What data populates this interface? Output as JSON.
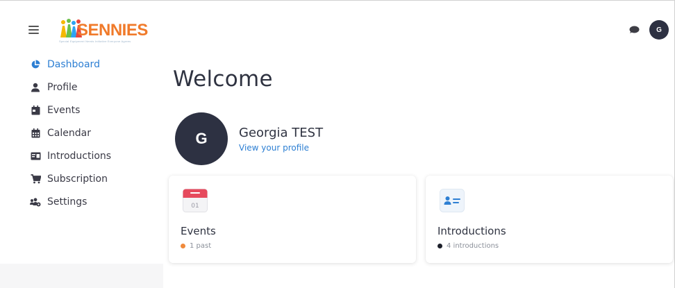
{
  "app": {
    "logo_text": "SENNIES",
    "logo_tagline": "Special Equipment Needs Initiative Everyone Agrees"
  },
  "header": {
    "user_initial": "G",
    "chat_icon": "chat-bubble-icon",
    "menu_icon": "hamburger-menu-icon"
  },
  "sidebar": {
    "items": [
      {
        "label": "Dashboard",
        "icon": "pie-chart-icon",
        "active": true
      },
      {
        "label": "Profile",
        "icon": "user-icon"
      },
      {
        "label": "Events",
        "icon": "calendar-day-icon"
      },
      {
        "label": "Calendar",
        "icon": "calendar-grid-icon"
      },
      {
        "label": "Introductions",
        "icon": "id-card-icon"
      },
      {
        "label": "Subscription",
        "icon": "shopping-cart-icon"
      },
      {
        "label": "Settings",
        "icon": "users-gear-icon"
      }
    ]
  },
  "main": {
    "welcome": "Welcome",
    "profile": {
      "initial": "G",
      "name": "Georgia TEST",
      "link": "View your profile"
    },
    "cards": {
      "events": {
        "title": "Events",
        "icon_day": "01",
        "meta": "1 past",
        "dot_color": "#f08a3c"
      },
      "introductions": {
        "title": "Introductions",
        "meta": "4 introductions",
        "dot_color": "#1c1f2a"
      }
    }
  },
  "colors": {
    "accent": "#2d7fd3",
    "avatar": "#2d3142",
    "logo_orange": "#f07a2a",
    "calendar_red": "#e64a5d"
  }
}
